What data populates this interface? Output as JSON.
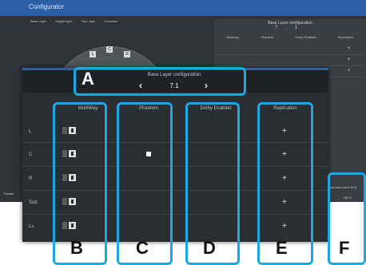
{
  "app": {
    "title": "Configurator",
    "top_strip": [
      "Base Layer",
      "Height layer",
      "Top Layer",
      "Overview"
    ],
    "top_number": "7.1",
    "speaker_nodes": [
      "L",
      "C",
      "R"
    ],
    "right_panel": {
      "title": "Base Layer configuration",
      "value": "7.1",
      "columns": [
        "Multiway",
        "Phantom",
        "Dolby Enabled",
        "Replication"
      ]
    },
    "right_footer": "Channels used: 8/16",
    "right_next": "NEXT",
    "left_footer": "Theater"
  },
  "dialog": {
    "title": "Base Layer configuration",
    "value": "7.1",
    "columns": [
      "MultiWay",
      "Phantom",
      "Dolby Enabled",
      "Replication"
    ],
    "rows": [
      {
        "label": "L",
        "phantom": false
      },
      {
        "label": "C",
        "phantom": true
      },
      {
        "label": "R",
        "phantom": false
      },
      {
        "label": "Sub",
        "phantom": false
      },
      {
        "label": "Ls",
        "phantom": false
      }
    ],
    "replication_symbol": "+"
  },
  "callouts": {
    "A": "A",
    "B": "B",
    "C": "C",
    "D": "D",
    "E": "E",
    "F": "F"
  },
  "colors": {
    "accent": "#2b5fa8",
    "highlight": "#1aa7e4",
    "dialog_bg": "#2b2e31"
  }
}
